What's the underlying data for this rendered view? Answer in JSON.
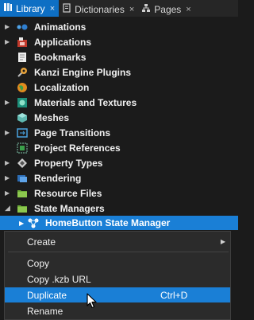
{
  "tabs": [
    {
      "label": "Library",
      "icon": "library-icon",
      "close": "×"
    },
    {
      "label": "Dictionaries",
      "icon": "dictionary-icon",
      "close": "×"
    },
    {
      "label": "Pages",
      "icon": "pages-icon",
      "close": "×"
    }
  ],
  "tree": {
    "items": [
      {
        "label": "Animations",
        "icon": "animations-icon",
        "expandable": true
      },
      {
        "label": "Applications",
        "icon": "applications-icon",
        "expandable": true
      },
      {
        "label": "Bookmarks",
        "icon": "bookmarks-icon",
        "expandable": false
      },
      {
        "label": "Kanzi Engine Plugins",
        "icon": "plugins-icon",
        "expandable": false
      },
      {
        "label": "Localization",
        "icon": "localization-icon",
        "expandable": false
      },
      {
        "label": "Materials and Textures",
        "icon": "materials-icon",
        "expandable": true
      },
      {
        "label": "Meshes",
        "icon": "meshes-icon",
        "expandable": false
      },
      {
        "label": "Page Transitions",
        "icon": "page-transitions-icon",
        "expandable": true
      },
      {
        "label": "Project References",
        "icon": "project-references-icon",
        "expandable": false
      },
      {
        "label": "Property Types",
        "icon": "property-types-icon",
        "expandable": true
      },
      {
        "label": "Rendering",
        "icon": "rendering-icon",
        "expandable": true
      },
      {
        "label": "Resource Files",
        "icon": "resource-files-icon",
        "expandable": true
      },
      {
        "label": "State Managers",
        "icon": "state-managers-icon",
        "expandable": true,
        "expanded": true
      }
    ],
    "selected_child": {
      "label": "HomeButton State Manager",
      "icon": "state-manager-icon"
    }
  },
  "context_menu": {
    "items": [
      {
        "label": "Create",
        "has_submenu": true,
        "shortcut": ""
      },
      {
        "label": "Copy",
        "shortcut": ""
      },
      {
        "label": "Copy .kzb URL",
        "shortcut": ""
      },
      {
        "label": "Duplicate",
        "shortcut": "Ctrl+D",
        "highlighted": true
      },
      {
        "label": "Rename",
        "shortcut": ""
      }
    ]
  },
  "colors": {
    "accent": "#1a7fd6",
    "background": "#1b1b1b",
    "menu_background": "#2b2b2b"
  }
}
